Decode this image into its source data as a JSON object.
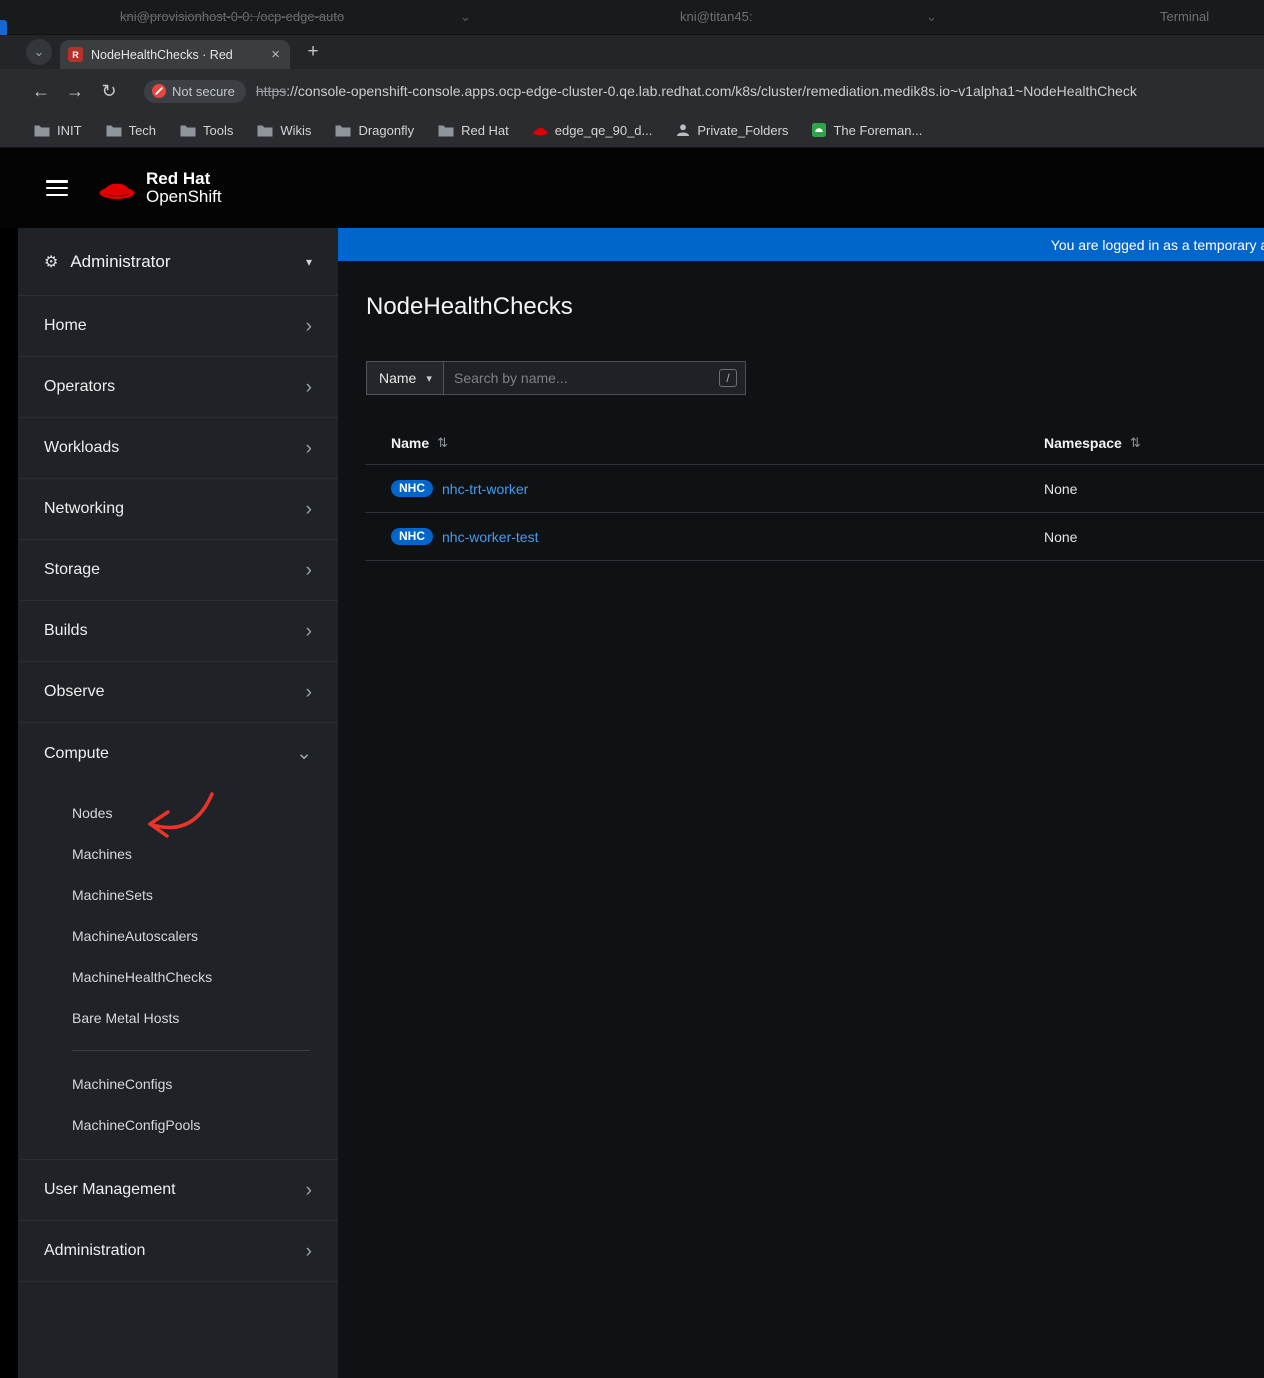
{
  "icons": {
    "tab_search": "⌄",
    "close": "×",
    "new_tab": "+",
    "back": "←",
    "forward": "→",
    "reload": "↻",
    "gear": "⚙",
    "caret_down": "▾",
    "chevron_right": "›",
    "chevron_down": "⌄",
    "sort": "⇅"
  },
  "terminal_bar": {
    "left_title": "kni@provisionhost-0-0: /ocp-edge-auto",
    "mid_title": "kni@titan45:",
    "right_title": "Terminal"
  },
  "browser": {
    "tab_title": "NodeHealthChecks · Red",
    "favicon_letter": "R",
    "security_label": "Not secure",
    "url_scheme": "https",
    "url_rest": "://console-openshift-console.apps.ocp-edge-cluster-0.qe.lab.redhat.com/k8s/cluster/remediation.medik8s.io~v1alpha1~NodeHealthCheck",
    "bookmarks": [
      {
        "label": "INIT"
      },
      {
        "label": "Tech"
      },
      {
        "label": "Tools"
      },
      {
        "label": "Wikis"
      },
      {
        "label": "Dragonfly"
      },
      {
        "label": "Red Hat"
      },
      {
        "label": "edge_qe_90_d..."
      },
      {
        "label": "Private_Folders"
      },
      {
        "label": "The Foreman..."
      }
    ]
  },
  "masthead": {
    "brand_top": "Red Hat",
    "brand_bottom": "OpenShift"
  },
  "banner_text": "You are logged in as a temporary ad",
  "sidebar": {
    "perspective": "Administrator",
    "items": [
      {
        "label": "Home"
      },
      {
        "label": "Operators"
      },
      {
        "label": "Workloads"
      },
      {
        "label": "Networking"
      },
      {
        "label": "Storage"
      },
      {
        "label": "Builds"
      },
      {
        "label": "Observe"
      },
      {
        "label": "Compute"
      },
      {
        "label": "User Management"
      },
      {
        "label": "Administration"
      }
    ],
    "compute_children": [
      {
        "label": "Nodes"
      },
      {
        "label": "Machines"
      },
      {
        "label": "MachineSets"
      },
      {
        "label": "MachineAutoscalers"
      },
      {
        "label": "MachineHealthChecks"
      },
      {
        "label": "Bare Metal Hosts"
      },
      {
        "label": "MachineConfigs"
      },
      {
        "label": "MachineConfigPools"
      }
    ]
  },
  "page": {
    "title": "NodeHealthChecks",
    "filter_dropdown": "Name",
    "search_placeholder": "Search by name...",
    "search_shortcut": "/",
    "table": {
      "col_name": "Name",
      "col_namespace": "Namespace",
      "rows": [
        {
          "badge": "NHC",
          "name": "nhc-trt-worker",
          "namespace": "None"
        },
        {
          "badge": "NHC",
          "name": "nhc-worker-test",
          "namespace": "None"
        }
      ]
    }
  }
}
